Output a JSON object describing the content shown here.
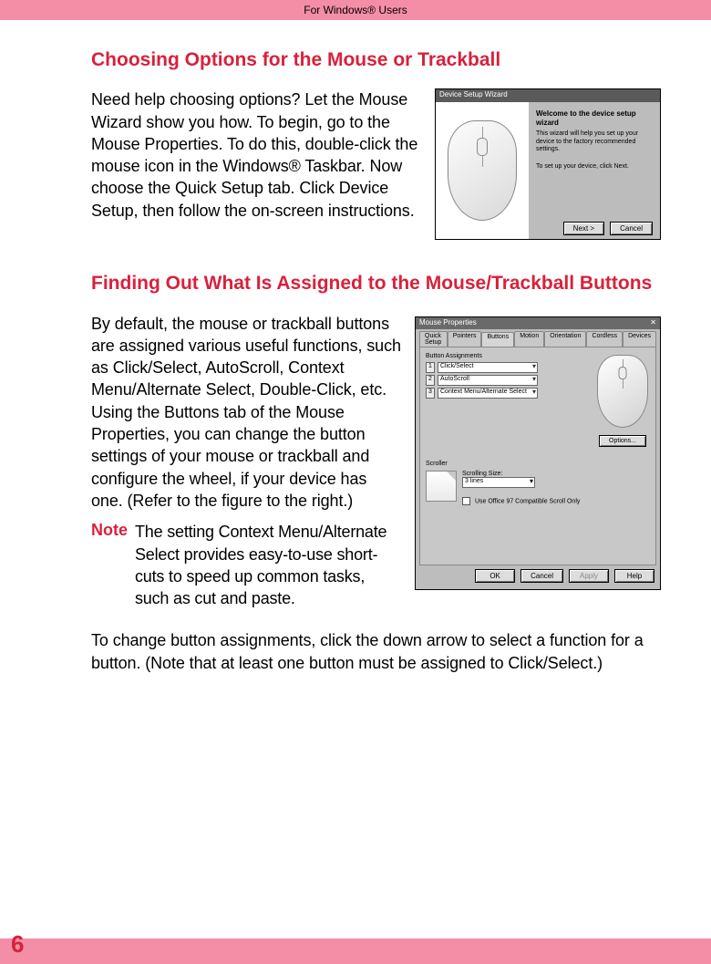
{
  "header": {
    "title": "For Windows® Users"
  },
  "section1": {
    "heading": "Choosing Options for the Mouse or Trackball",
    "body": "Need help choosing options? Let the Mouse Wizard show you how. To begin, go to the Mouse Properties. To do this, double-click the mouse icon in the Windows® Taskbar. Now choose the Quick Setup tab. Click Device Setup, then follow the on-screen instructions."
  },
  "figure1": {
    "title": "Device Setup Wizard",
    "welcome": "Welcome to the device setup wizard",
    "desc": "This wizard will help you set up your device to the factory recommended settings.",
    "hint": "To set up your device, click Next.",
    "buttons": {
      "next": "Next >",
      "cancel": "Cancel"
    }
  },
  "section2": {
    "heading": "Finding Out What Is Assigned to the Mouse/Trackball Buttons",
    "body": "By default, the mouse or trackball buttons are assigned various useful functions, such as Click/Select, AutoScroll, Context Menu/Alternate Select, Double-Click, etc. Using the Buttons tab of the Mouse Properties, you can change the button settings of your mouse or trackball and configure the wheel, if your device has one. (Refer to the figure to the right.)",
    "note_label": "Note",
    "note_text": "The setting Context Menu/Alternate Select provides easy-to-use short-cuts to speed up common tasks, such as cut and paste.",
    "after": "To change button assignments, click the down arrow to select a function for a button. (Note that at least one button must be assigned to Click/Select.)"
  },
  "figure2": {
    "title": "Mouse Properties",
    "tabs": [
      "Quick Setup",
      "Pointers",
      "Buttons",
      "Motion",
      "Orientation",
      "Cordless",
      "Devices"
    ],
    "active_tab": "Buttons",
    "group_label": "Button Assignments",
    "assignments": [
      {
        "n": "1",
        "value": "Click/Select"
      },
      {
        "n": "2",
        "value": "AutoScroll"
      },
      {
        "n": "3",
        "value": "Context Menu/Alternate Select"
      }
    ],
    "options_btn": "Options...",
    "scroller": {
      "label": "Scroller",
      "size_label": "Scrolling Size:",
      "size_value": "3 lines",
      "compat": "Use Office 97 Compatible Scroll Only"
    },
    "buttons": {
      "ok": "OK",
      "cancel": "Cancel",
      "apply": "Apply",
      "help": "Help"
    }
  },
  "footer": {
    "page": "6"
  }
}
